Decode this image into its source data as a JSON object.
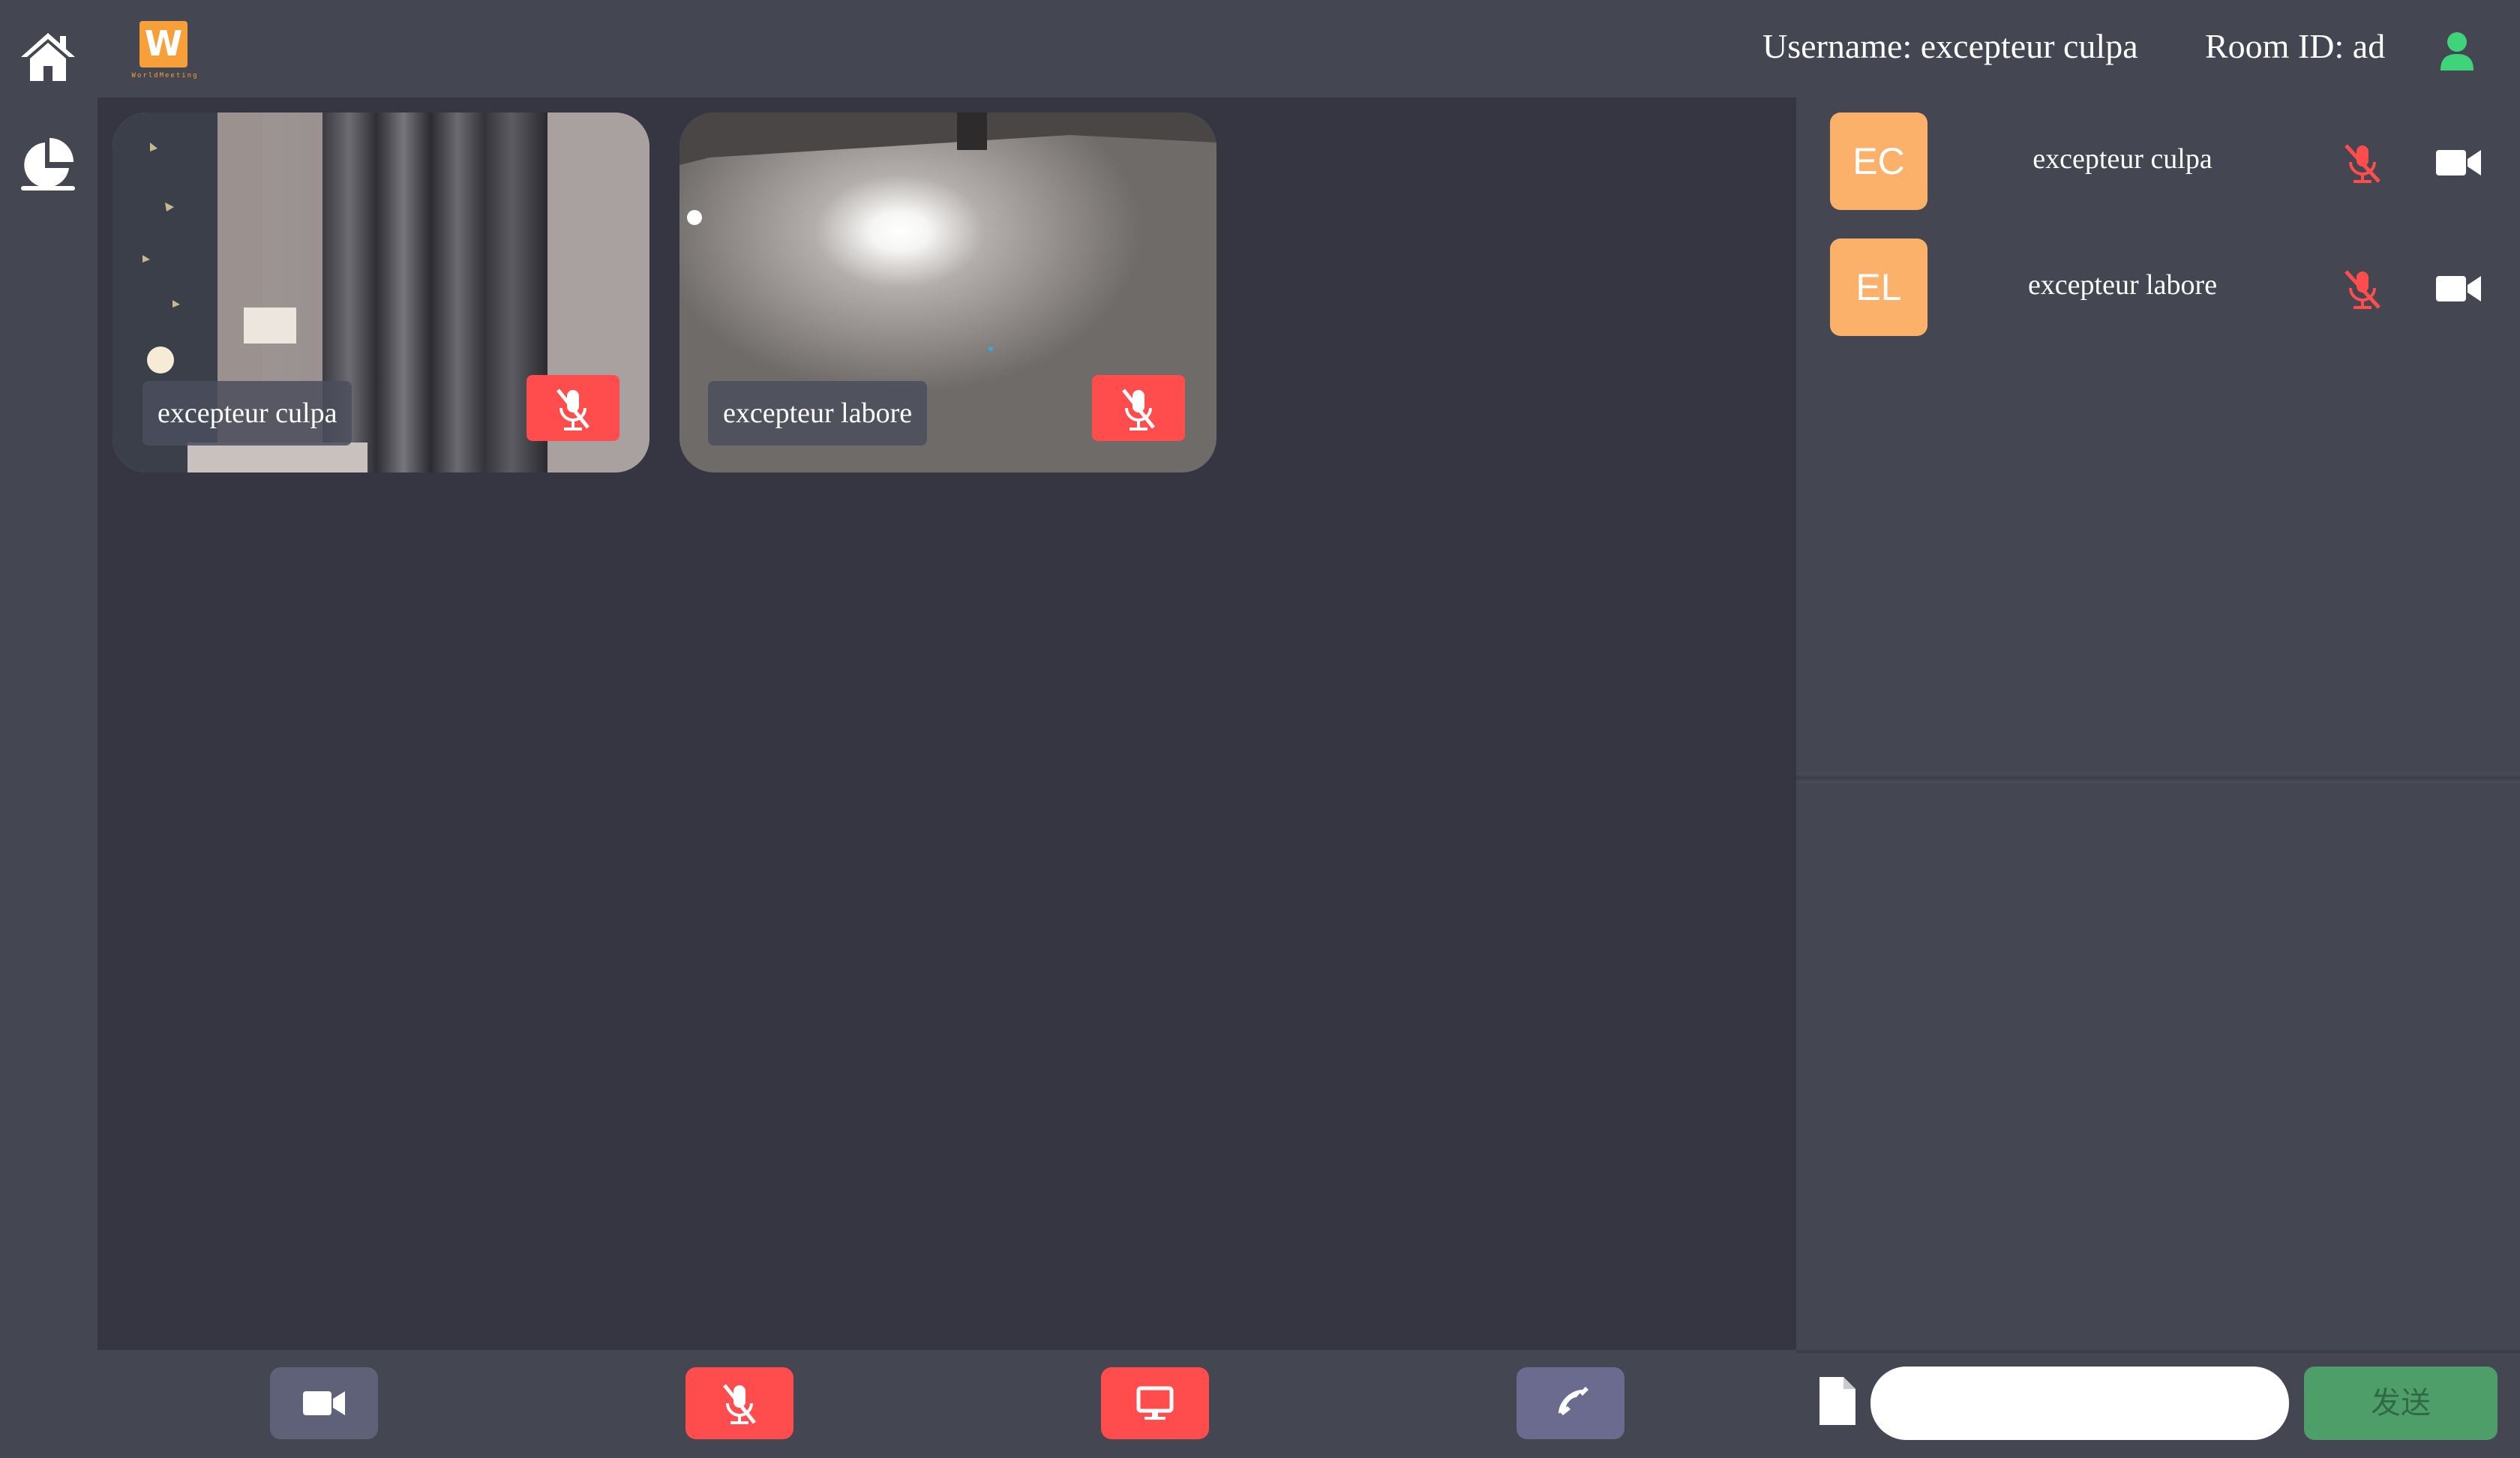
{
  "app": {
    "logo_letter": "W",
    "logo_subtitle": "WorldMeeting"
  },
  "header": {
    "username_label": "Username: excepteur culpa",
    "room_label": "Room ID: ad"
  },
  "rail": {
    "items": [
      {
        "name": "home",
        "icon": "home-icon"
      },
      {
        "name": "stats",
        "icon": "pie-chart-icon"
      }
    ]
  },
  "videos": [
    {
      "name": "excepteur culpa",
      "mic_muted": true
    },
    {
      "name": "excepteur labore",
      "mic_muted": true
    }
  ],
  "participants": [
    {
      "initials": "EC",
      "name": "excepteur culpa",
      "mic_icon": "mic-muted-icon",
      "camera_icon": "video-camera-icon"
    },
    {
      "initials": "EL",
      "name": "excepteur labore",
      "mic_icon": "mic-muted-icon",
      "camera_icon": "video-camera-icon"
    }
  ],
  "controls": [
    {
      "name": "camera",
      "icon": "video-camera-icon",
      "color": "#5f6178"
    },
    {
      "name": "mic",
      "icon": "mic-muted-icon",
      "color": "#ff4d4d"
    },
    {
      "name": "screen-share",
      "icon": "monitor-icon",
      "color": "#ff4d4d"
    },
    {
      "name": "hang-up",
      "icon": "phone-icon",
      "color": "#6a6b8e"
    }
  ],
  "chat": {
    "input_value": "",
    "send_label": "发送"
  },
  "colors": {
    "accent_orange": "#f7a03a",
    "avatar": "#fcb16b",
    "muted_red": "#ff4d4d",
    "user_green": "#3fd47a",
    "send_green": "#4e9e6a"
  }
}
